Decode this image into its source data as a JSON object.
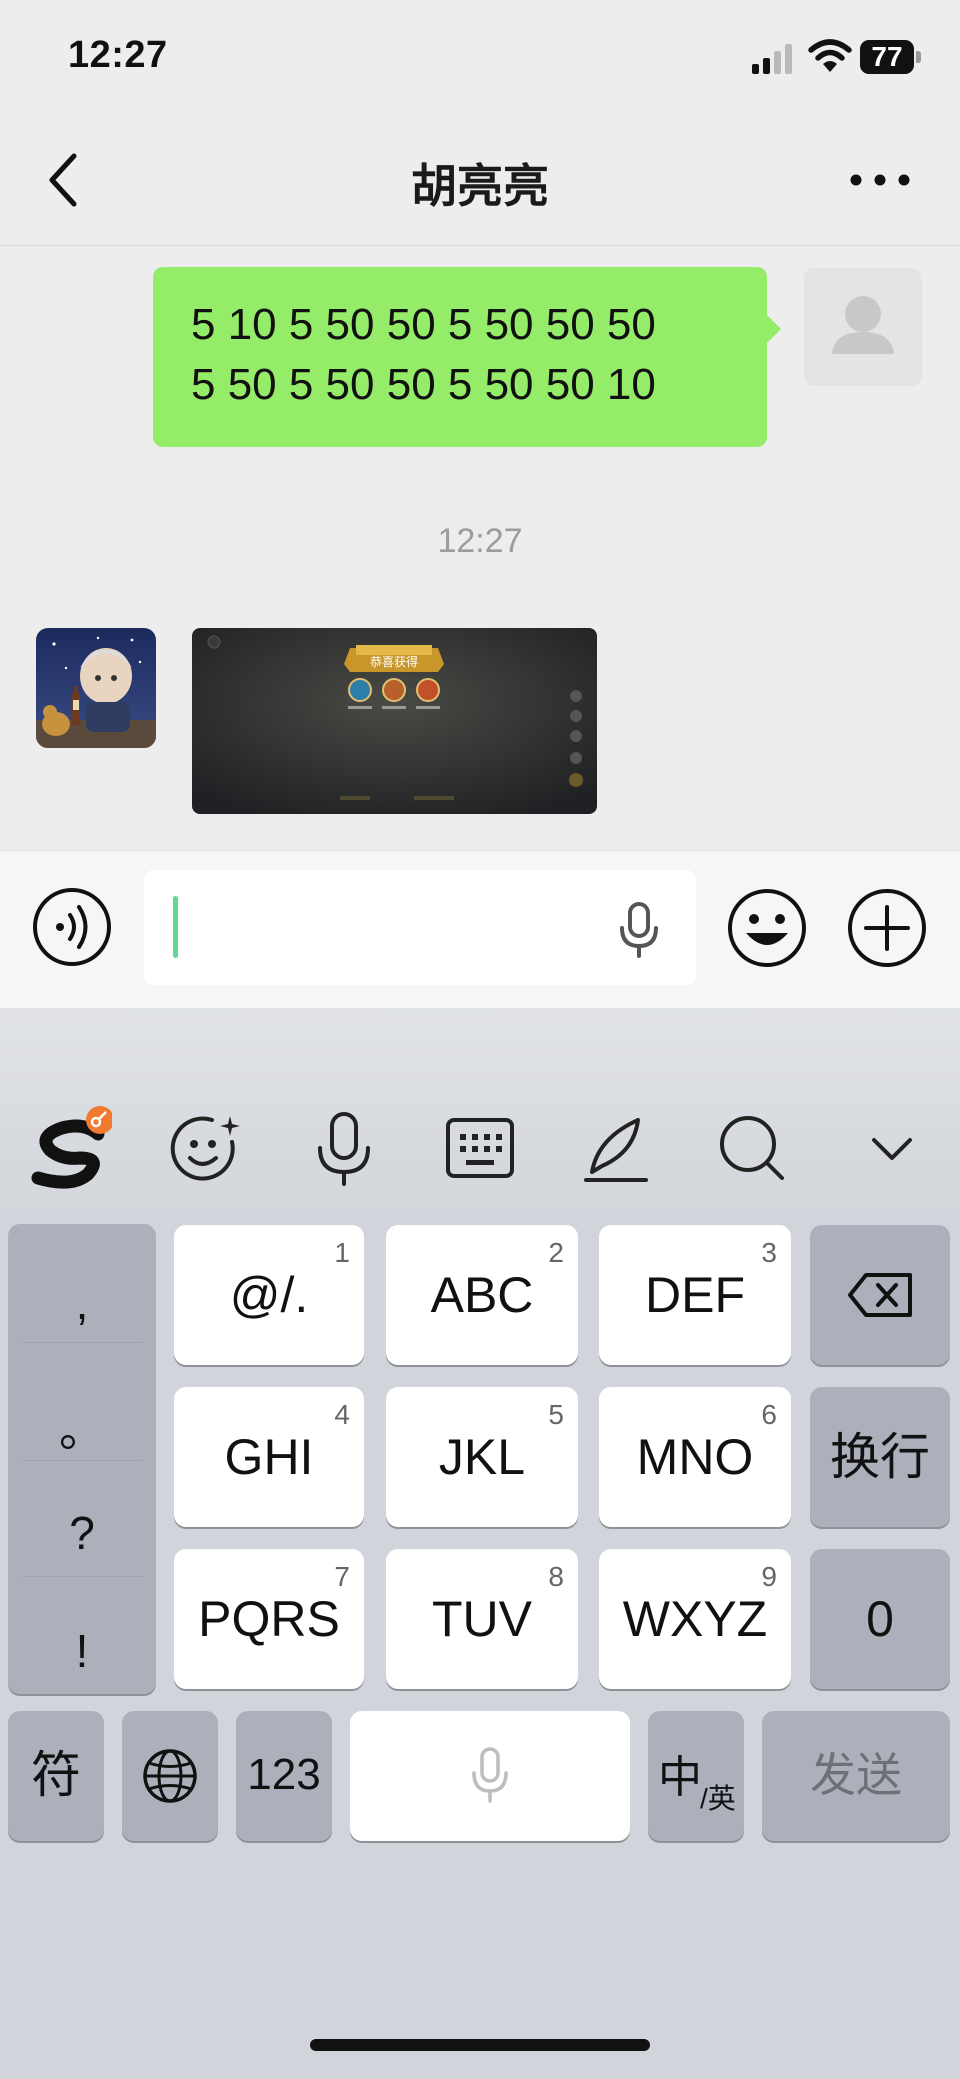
{
  "status_bar": {
    "time": "12:27",
    "battery": "77"
  },
  "header": {
    "title": "胡亮亮"
  },
  "messages": {
    "outgoing_line1": "5 10 5 50 50 5 50 50 50",
    "outgoing_line2": "5 50 5 50 50 5 50 50 10",
    "timestamp": "12:27",
    "game_banner": "恭喜获得"
  },
  "input": {
    "value": ""
  },
  "keyboard": {
    "punctuation": [
      ",",
      "。",
      "?",
      "!"
    ],
    "keys": {
      "k1": {
        "label": "@/.",
        "num": "1"
      },
      "k2": {
        "label": "ABC",
        "num": "2"
      },
      "k3": {
        "label": "DEF",
        "num": "3"
      },
      "k4": {
        "label": "GHI",
        "num": "4"
      },
      "k5": {
        "label": "JKL",
        "num": "5"
      },
      "k6": {
        "label": "MNO",
        "num": "6"
      },
      "k7": {
        "label": "PQRS",
        "num": "7"
      },
      "k8": {
        "label": "TUV",
        "num": "8"
      },
      "k9": {
        "label": "WXYZ",
        "num": "9"
      }
    },
    "newline": "换行",
    "zero": "0",
    "symbols": "符",
    "numbers": "123",
    "lang_main": "中",
    "lang_alt": "/英",
    "send": "发送"
  },
  "colors": {
    "bubble_green": "#95ec69",
    "accent": "#07c160",
    "orange_badge": "#f07a2f"
  }
}
